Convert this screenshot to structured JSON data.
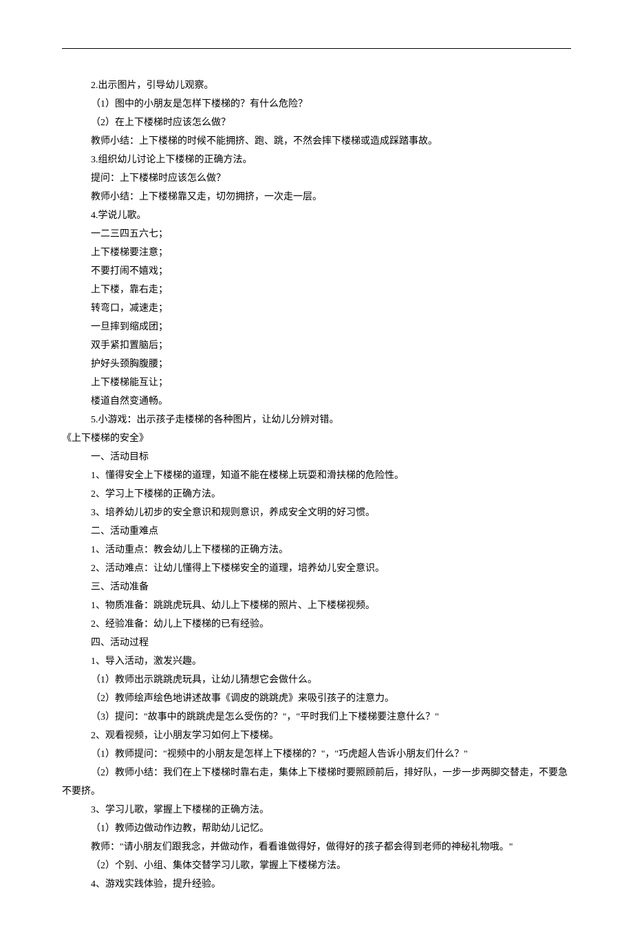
{
  "lines": [
    {
      "indent": 2,
      "text": "2.出示图片，引导幼儿观察。"
    },
    {
      "indent": 2,
      "text": "（1）图中的小朋友是怎样下楼梯的？有什么危险？"
    },
    {
      "indent": 2,
      "text": "（2）在上下楼梯时应该怎么做？"
    },
    {
      "indent": 2,
      "text": "教师小结：上下楼梯的时候不能拥挤、跑、跳，不然会摔下楼梯或造成踩踏事故。"
    },
    {
      "indent": 2,
      "text": "3.组织幼儿讨论上下楼梯的正确方法。"
    },
    {
      "indent": 2,
      "text": "提问：上下楼梯时应该怎么做？"
    },
    {
      "indent": 2,
      "text": "教师小结：上下楼梯靠又走，切勿拥挤，一次走一层。"
    },
    {
      "indent": 2,
      "text": "4.学说儿歌。"
    },
    {
      "indent": 2,
      "text": "一二三四五六七；"
    },
    {
      "indent": 2,
      "text": "上下楼梯要注意；"
    },
    {
      "indent": 2,
      "text": "不要打闹不嬉戏；"
    },
    {
      "indent": 2,
      "text": "上下楼，靠右走；"
    },
    {
      "indent": 2,
      "text": "转弯口，减速走；"
    },
    {
      "indent": 2,
      "text": "一旦摔到缩成团；"
    },
    {
      "indent": 2,
      "text": "双手紧扣置脑后；"
    },
    {
      "indent": 2,
      "text": "护好头颈胸腹腰；"
    },
    {
      "indent": 2,
      "text": "上下楼梯能互让；"
    },
    {
      "indent": 2,
      "text": "楼道自然变通畅。"
    },
    {
      "indent": 2,
      "text": "5.小游戏：出示孩子走楼梯的各种图片，让幼儿分辨对错。"
    },
    {
      "indent": 0,
      "text": "《上下楼梯的安全》"
    },
    {
      "indent": 2,
      "text": "一、活动目标"
    },
    {
      "indent": 2,
      "text": "1、懂得安全上下楼梯的道理，知道不能在楼梯上玩耍和滑扶梯的危险性。"
    },
    {
      "indent": 2,
      "text": "2、学习上下楼梯的正确方法。"
    },
    {
      "indent": 2,
      "text": "3、培养幼儿初步的安全意识和规则意识，养成安全文明的好习惯。"
    },
    {
      "indent": 2,
      "text": "二、活动重难点"
    },
    {
      "indent": 2,
      "text": "1、活动重点：教会幼儿上下楼梯的正确方法。"
    },
    {
      "indent": 2,
      "text": "2、活动难点：让幼儿懂得上下楼梯安全的道理，培养幼儿安全意识。"
    },
    {
      "indent": 2,
      "text": "三、活动准备"
    },
    {
      "indent": 2,
      "text": "1、物质准备：跳跳虎玩具、幼儿上下楼梯的照片、上下楼梯视频。"
    },
    {
      "indent": 2,
      "text": "2、经验准备：幼儿上下楼梯的已有经验。"
    },
    {
      "indent": 2,
      "text": "四、活动过程"
    },
    {
      "indent": 2,
      "text": "1、导入活动，激发兴趣。"
    },
    {
      "indent": 2,
      "text": "（1）教师出示跳跳虎玩具，让幼儿猜想它会做什么。"
    },
    {
      "indent": 2,
      "text": "（2）教师绘声绘色地讲述故事《调皮的跳跳虎》来吸引孩子的注意力。"
    },
    {
      "indent": 2,
      "text": "（3）提问：\"故事中的跳跳虎是怎么受伤的？\"，\"平时我们上下楼梯要注意什么？\""
    },
    {
      "indent": 2,
      "text": "2、观看视频，让小朋友学习如何上下楼梯。"
    },
    {
      "indent": 2,
      "text": "（1）教师提问：\"视频中的小朋友是怎样上下楼梯的？\"，\"巧虎超人告诉小朋友们什么？\""
    },
    {
      "indent": 2,
      "text": "（2）教师小结：我们在上下楼梯时靠右走，集体上下楼梯时要照顾前后，排好队，一步一步两脚交替走，不要急"
    },
    {
      "indent": 0,
      "text": "不要挤。"
    },
    {
      "indent": 2,
      "text": "3、学习儿歌，掌握上下楼梯的正确方法。"
    },
    {
      "indent": 2,
      "text": "（1）教师边做动作边教，帮助幼儿记忆。"
    },
    {
      "indent": 2,
      "text": "教师：\"请小朋友们跟我念，并做动作，看看谁做得好，做得好的孩子都会得到老师的神秘礼物哦。\""
    },
    {
      "indent": 2,
      "text": "（2）个别、小组、集体交替学习儿歌，掌握上下楼梯方法。"
    },
    {
      "indent": 2,
      "text": "4、游戏实践体验，提升经验。"
    }
  ]
}
